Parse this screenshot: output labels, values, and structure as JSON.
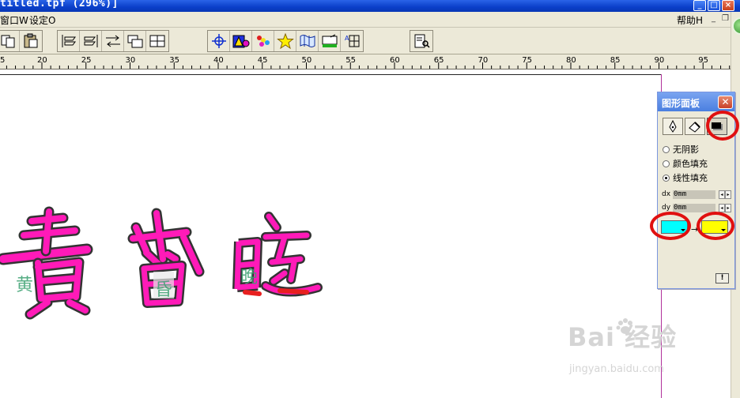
{
  "window": {
    "title": "titled.tpf (296%)]",
    "controls": {
      "minimize": "_",
      "maximize": "□",
      "close": "×"
    }
  },
  "menubar": {
    "left_items": [
      "窗口W",
      "设定O"
    ],
    "help": "帮助H",
    "mdi_controls": {
      "minimize": "_",
      "restore": "❐"
    }
  },
  "toolbar": {
    "groups": [
      [
        "copy-icon",
        "paste-icon"
      ],
      [
        "align-left-icon",
        "align-right-icon",
        "distribute-icon",
        "layer-order-icon",
        "group-icon"
      ],
      [
        "crosshair-move-icon",
        "shape-fill-icon",
        "color-blend-icon",
        "star-icon",
        "map-wave-icon",
        "sign-icon",
        "text-grid-icon"
      ],
      [
        "preview-icon"
      ]
    ]
  },
  "ruler": {
    "labels": [
      "5",
      "20",
      "25",
      "30",
      "35",
      "40",
      "45",
      "50",
      "55",
      "60",
      "65",
      "70",
      "75",
      "80",
      "85",
      "90",
      "95"
    ]
  },
  "panel": {
    "title": "图形面板",
    "tabs": [
      "pen-icon",
      "eraser-icon",
      "shadow-icon"
    ],
    "active_tab": 2,
    "fill_options": [
      {
        "label": "无阴影",
        "checked": false
      },
      {
        "label": "颜色填充",
        "checked": false
      },
      {
        "label": "线性填充",
        "checked": true
      }
    ],
    "dx": {
      "label": "dx",
      "value": "0mm"
    },
    "dy": {
      "label": "dy",
      "value": "0mm"
    },
    "start_color": "#00ffff",
    "end_color": "#ffff00",
    "arrow": "→",
    "info_button": "!"
  },
  "canvas": {
    "art_text": [
      "黄",
      "昏",
      "晚"
    ],
    "text_fill": "#ff1ab8",
    "text_stroke": "#333333"
  },
  "watermark": {
    "main": "Bai  经验",
    "sub": "jingyan.baidu.com"
  },
  "colors": {
    "highlight": "#e01010",
    "chrome": "#ece9d8",
    "title_blue": "#0a3fc9"
  }
}
